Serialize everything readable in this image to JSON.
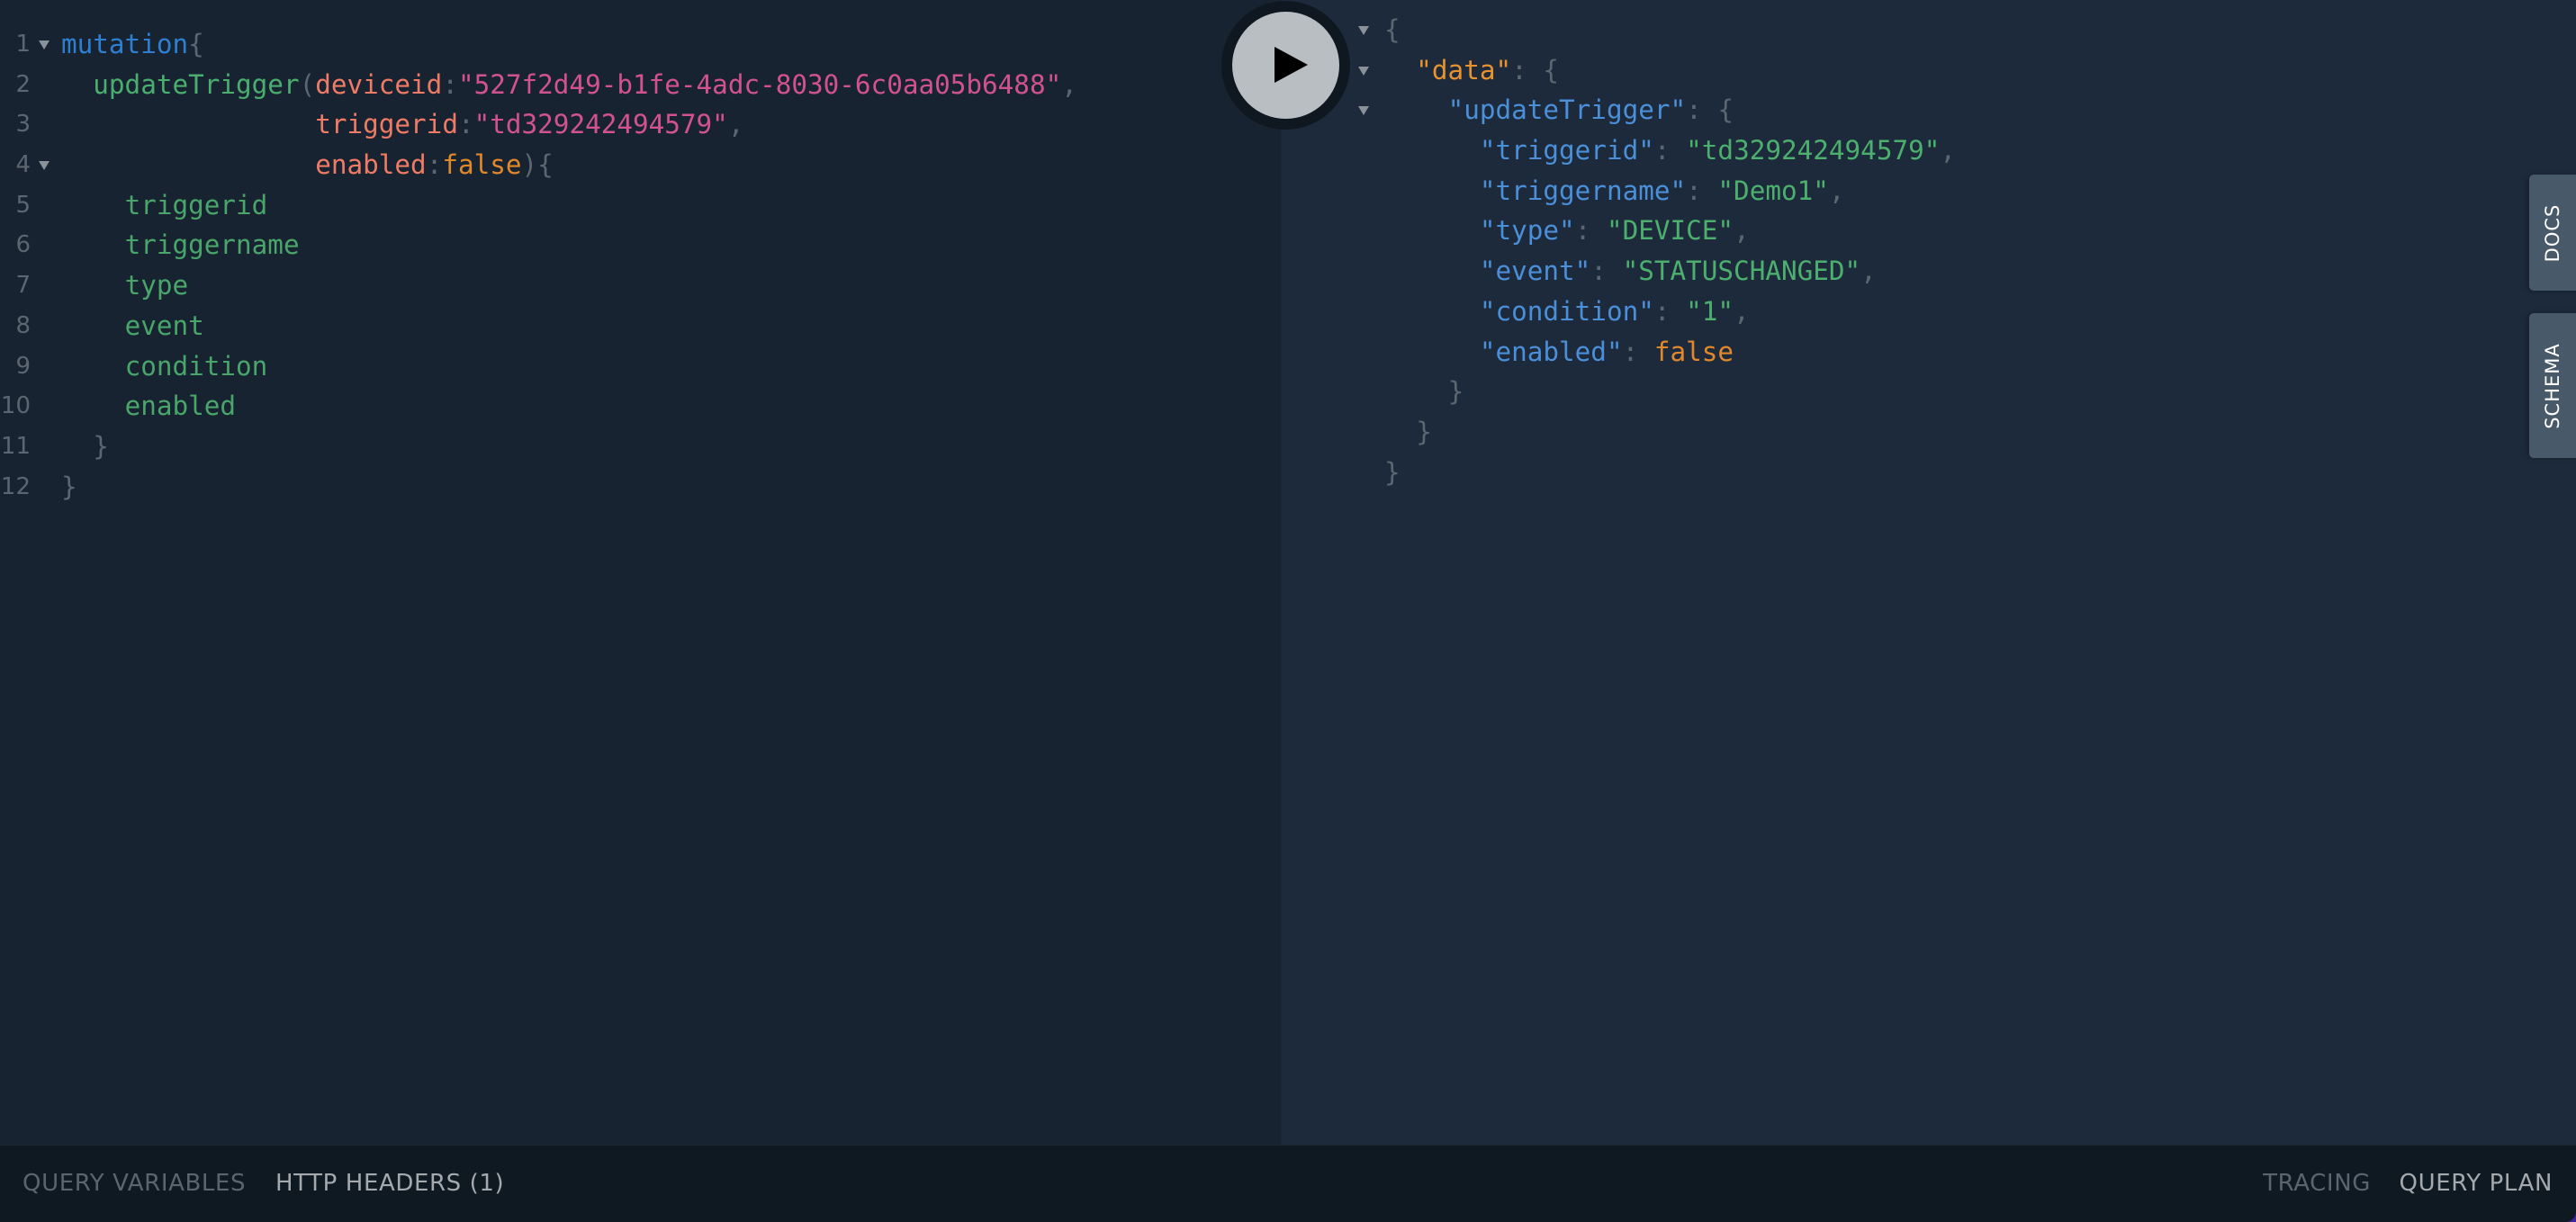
{
  "editor": {
    "lines": [
      {
        "num": "1",
        "fold": true,
        "tokens": [
          {
            "t": "mutation",
            "c": "c-kw"
          },
          {
            "t": "{",
            "c": "c-punc"
          }
        ]
      },
      {
        "num": "2",
        "fold": false,
        "tokens": [
          {
            "t": "  ",
            "c": ""
          },
          {
            "t": "updateTrigger",
            "c": "c-fn"
          },
          {
            "t": "(",
            "c": "c-punc"
          },
          {
            "t": "deviceid",
            "c": "c-arg"
          },
          {
            "t": ":",
            "c": "c-punc"
          },
          {
            "t": "\"527f2d49-b1fe-4adc-8030-6c0aa05b6488\"",
            "c": "c-str"
          },
          {
            "t": ",",
            "c": "c-punc"
          }
        ]
      },
      {
        "num": "3",
        "fold": false,
        "tokens": [
          {
            "t": "                ",
            "c": ""
          },
          {
            "t": "triggerid",
            "c": "c-arg"
          },
          {
            "t": ":",
            "c": "c-punc"
          },
          {
            "t": "\"td329242494579\"",
            "c": "c-str"
          },
          {
            "t": ",",
            "c": "c-punc"
          }
        ]
      },
      {
        "num": "4",
        "fold": true,
        "tokens": [
          {
            "t": "                ",
            "c": ""
          },
          {
            "t": "enabled",
            "c": "c-arg"
          },
          {
            "t": ":",
            "c": "c-punc"
          },
          {
            "t": "false",
            "c": "c-bool"
          },
          {
            "t": "){",
            "c": "c-punc"
          }
        ]
      },
      {
        "num": "5",
        "fold": false,
        "tokens": [
          {
            "t": "    ",
            "c": ""
          },
          {
            "t": "triggerid",
            "c": "c-field"
          }
        ]
      },
      {
        "num": "6",
        "fold": false,
        "tokens": [
          {
            "t": "    ",
            "c": ""
          },
          {
            "t": "triggername",
            "c": "c-field"
          }
        ]
      },
      {
        "num": "7",
        "fold": false,
        "tokens": [
          {
            "t": "    ",
            "c": ""
          },
          {
            "t": "type",
            "c": "c-field"
          }
        ]
      },
      {
        "num": "8",
        "fold": false,
        "tokens": [
          {
            "t": "    ",
            "c": ""
          },
          {
            "t": "event",
            "c": "c-field"
          }
        ]
      },
      {
        "num": "9",
        "fold": false,
        "tokens": [
          {
            "t": "    ",
            "c": ""
          },
          {
            "t": "condition",
            "c": "c-field"
          }
        ]
      },
      {
        "num": "10",
        "fold": false,
        "tokens": [
          {
            "t": "    ",
            "c": ""
          },
          {
            "t": "enabled",
            "c": "c-field"
          }
        ]
      },
      {
        "num": "11",
        "fold": false,
        "tokens": [
          {
            "t": "  ",
            "c": ""
          },
          {
            "t": "}",
            "c": "c-punc"
          }
        ]
      },
      {
        "num": "12",
        "fold": false,
        "tokens": [
          {
            "t": "}",
            "c": "c-punc"
          }
        ]
      }
    ]
  },
  "run_button": {
    "icon": "play-icon",
    "label": "Execute Query"
  },
  "result": {
    "lines": [
      {
        "fold": true,
        "tokens": [
          {
            "t": "{",
            "c": "c-punc"
          }
        ]
      },
      {
        "fold": true,
        "tokens": [
          {
            "t": "  ",
            "c": ""
          },
          {
            "t": "\"data\"",
            "c": "c-jkey-top"
          },
          {
            "t": ": {",
            "c": "c-punc"
          }
        ]
      },
      {
        "fold": true,
        "tokens": [
          {
            "t": "    ",
            "c": ""
          },
          {
            "t": "\"updateTrigger\"",
            "c": "c-jkey"
          },
          {
            "t": ": {",
            "c": "c-punc"
          }
        ]
      },
      {
        "fold": false,
        "tokens": [
          {
            "t": "      ",
            "c": ""
          },
          {
            "t": "\"triggerid\"",
            "c": "c-jkey"
          },
          {
            "t": ": ",
            "c": "c-punc"
          },
          {
            "t": "\"td329242494579\"",
            "c": "c-jstr"
          },
          {
            "t": ",",
            "c": "c-punc"
          }
        ]
      },
      {
        "fold": false,
        "tokens": [
          {
            "t": "      ",
            "c": ""
          },
          {
            "t": "\"triggername\"",
            "c": "c-jkey"
          },
          {
            "t": ": ",
            "c": "c-punc"
          },
          {
            "t": "\"Demo1\"",
            "c": "c-jstr"
          },
          {
            "t": ",",
            "c": "c-punc"
          }
        ]
      },
      {
        "fold": false,
        "tokens": [
          {
            "t": "      ",
            "c": ""
          },
          {
            "t": "\"type\"",
            "c": "c-jkey"
          },
          {
            "t": ": ",
            "c": "c-punc"
          },
          {
            "t": "\"DEVICE\"",
            "c": "c-jstr"
          },
          {
            "t": ",",
            "c": "c-punc"
          }
        ]
      },
      {
        "fold": false,
        "tokens": [
          {
            "t": "      ",
            "c": ""
          },
          {
            "t": "\"event\"",
            "c": "c-jkey"
          },
          {
            "t": ": ",
            "c": "c-punc"
          },
          {
            "t": "\"STATUSCHANGED\"",
            "c": "c-jstr"
          },
          {
            "t": ",",
            "c": "c-punc"
          }
        ]
      },
      {
        "fold": false,
        "tokens": [
          {
            "t": "      ",
            "c": ""
          },
          {
            "t": "\"condition\"",
            "c": "c-jkey"
          },
          {
            "t": ": ",
            "c": "c-punc"
          },
          {
            "t": "\"1\"",
            "c": "c-jstr"
          },
          {
            "t": ",",
            "c": "c-punc"
          }
        ]
      },
      {
        "fold": false,
        "tokens": [
          {
            "t": "      ",
            "c": ""
          },
          {
            "t": "\"enabled\"",
            "c": "c-jkey"
          },
          {
            "t": ": ",
            "c": "c-punc"
          },
          {
            "t": "false",
            "c": "c-jbool"
          }
        ]
      },
      {
        "fold": false,
        "tokens": [
          {
            "t": "    ",
            "c": ""
          },
          {
            "t": "}",
            "c": "c-punc"
          }
        ]
      },
      {
        "fold": false,
        "tokens": [
          {
            "t": "  ",
            "c": ""
          },
          {
            "t": "}",
            "c": "c-punc"
          }
        ]
      },
      {
        "fold": false,
        "tokens": [
          {
            "t": "}",
            "c": "c-punc"
          }
        ]
      }
    ]
  },
  "side_tabs": {
    "docs": "DOCS",
    "schema": "SCHEMA"
  },
  "bottom_bar": {
    "query_variables": "QUERY VARIABLES",
    "http_headers": "HTTP HEADERS (1)",
    "tracing": "TRACING",
    "query_plan": "QUERY PLAN"
  },
  "colors": {
    "editor_bg": "#172330",
    "result_bg": "#1d2a3b",
    "bottom_bar_bg": "#0f1922",
    "side_tab_bg": "#48596a",
    "run_button_bg": "#b9bec2",
    "keyword": "#2f7fd1",
    "field": "#49a56a",
    "argument": "#ef7a66",
    "string": "#d2528f",
    "boolean": "#e0882c",
    "json_key": "#4a8fd8",
    "json_string": "#4caf6e"
  }
}
